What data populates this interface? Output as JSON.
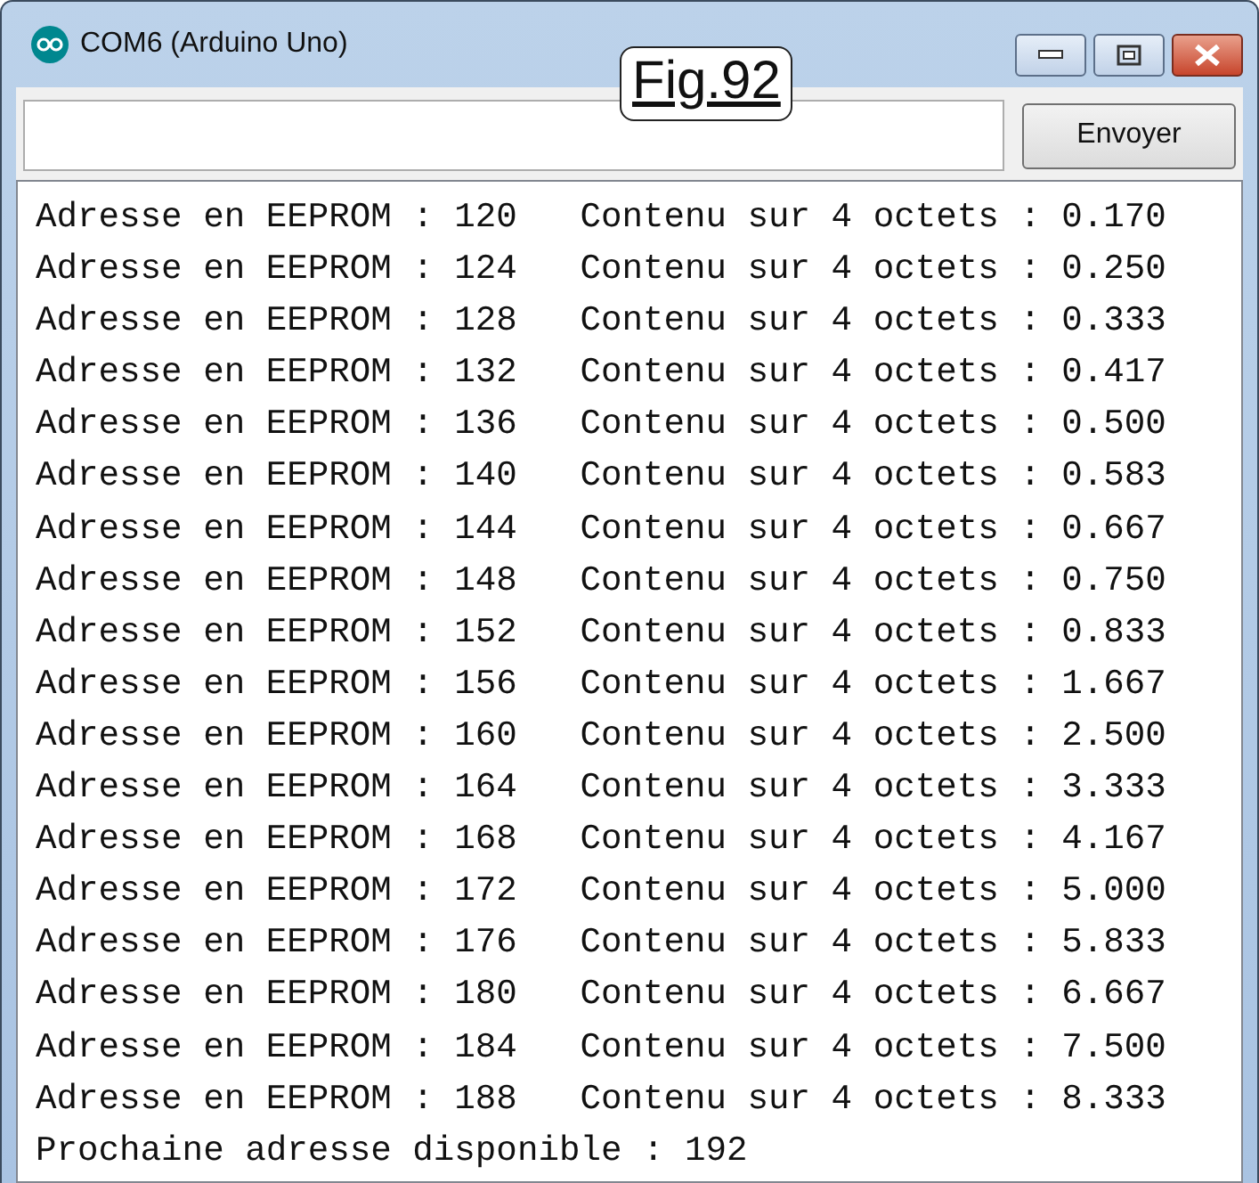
{
  "window": {
    "title": "COM6 (Arduino Uno)"
  },
  "figure_label": "Fig.92",
  "send_button": {
    "label": "Envoyer"
  },
  "output_lines": [
    "Adresse en EEPROM : 120   Contenu sur 4 octets : 0.170",
    "Adresse en EEPROM : 124   Contenu sur 4 octets : 0.250",
    "Adresse en EEPROM : 128   Contenu sur 4 octets : 0.333",
    "Adresse en EEPROM : 132   Contenu sur 4 octets : 0.417",
    "Adresse en EEPROM : 136   Contenu sur 4 octets : 0.500",
    "Adresse en EEPROM : 140   Contenu sur 4 octets : 0.583",
    "Adresse en EEPROM : 144   Contenu sur 4 octets : 0.667",
    "Adresse en EEPROM : 148   Contenu sur 4 octets : 0.750",
    "Adresse en EEPROM : 152   Contenu sur 4 octets : 0.833",
    "Adresse en EEPROM : 156   Contenu sur 4 octets : 1.667",
    "Adresse en EEPROM : 160   Contenu sur 4 octets : 2.500",
    "Adresse en EEPROM : 164   Contenu sur 4 octets : 3.333",
    "Adresse en EEPROM : 168   Contenu sur 4 octets : 4.167",
    "Adresse en EEPROM : 172   Contenu sur 4 octets : 5.000",
    "Adresse en EEPROM : 176   Contenu sur 4 octets : 5.833",
    "Adresse en EEPROM : 180   Contenu sur 4 octets : 6.667",
    "Adresse en EEPROM : 184   Contenu sur 4 octets : 7.500",
    "Adresse en EEPROM : 188   Contenu sur 4 octets : 8.333",
    "Prochaine adresse disponible : 192"
  ]
}
